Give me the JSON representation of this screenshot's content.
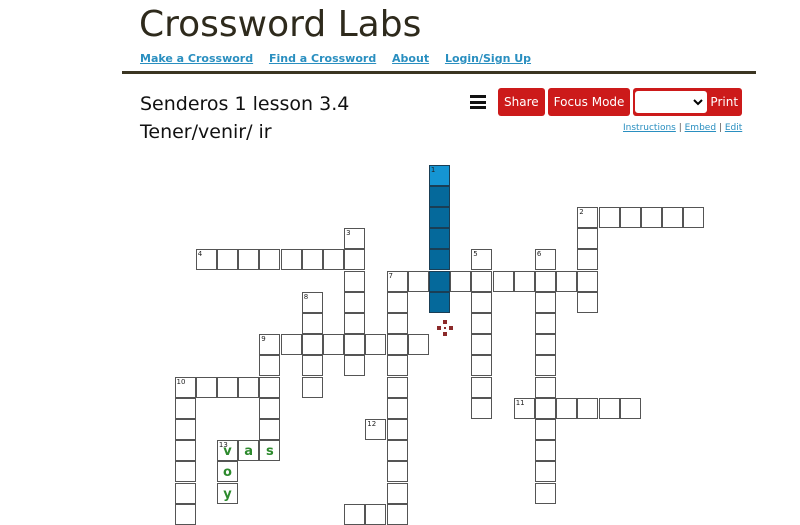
{
  "site": {
    "logo": "Crossword Labs",
    "nav": [
      "Make a Crossword",
      "Find a Crossword",
      "About",
      "Login/Sign Up"
    ]
  },
  "puzzle": {
    "title_line1": "Senderos 1 lesson 3.4",
    "title_line2": "Tener/venir/ ir"
  },
  "toolbar": {
    "menu_icon": "hamburger-menu-icon",
    "share_label": "Share",
    "focus_label": "Focus Mode",
    "print_select_value": "",
    "print_label": "Print"
  },
  "links": {
    "instructions": "Instructions",
    "embed": "Embed",
    "edit": "Edit",
    "separator": " | "
  },
  "colors": {
    "accent_red": "#cc1a1a",
    "highlight_word": "#05699b",
    "highlight_cell": "#1595d3",
    "entered_letter": "#2d8a2d",
    "link": "#2a8fc0"
  },
  "grid": {
    "words": [
      {
        "number": 1,
        "direction": "down",
        "col": 12,
        "row": 0,
        "length": 7,
        "active": true
      },
      {
        "number": 2,
        "direction": "across",
        "col": 19,
        "row": 2,
        "length": 6
      },
      {
        "number": 2,
        "direction": "down",
        "col": 19,
        "row": 2,
        "length": 5
      },
      {
        "number": 3,
        "direction": "down",
        "col": 8,
        "row": 3,
        "length": 7
      },
      {
        "number": 4,
        "direction": "across",
        "col": 1,
        "row": 4,
        "length": 8
      },
      {
        "number": 5,
        "direction": "down",
        "col": 14,
        "row": 4,
        "length": 8
      },
      {
        "number": 6,
        "direction": "down",
        "col": 17,
        "row": 4,
        "length": 12
      },
      {
        "number": 7,
        "direction": "across",
        "col": 10,
        "row": 5,
        "length": 10
      },
      {
        "number": 7,
        "direction": "down",
        "col": 10,
        "row": 5,
        "length": 12
      },
      {
        "number": 8,
        "direction": "down",
        "col": 6,
        "row": 6,
        "length": 5
      },
      {
        "number": 9,
        "direction": "across",
        "col": 4,
        "row": 8,
        "length": 8
      },
      {
        "number": 9,
        "direction": "down",
        "col": 4,
        "row": 8,
        "length": 6
      },
      {
        "number": 10,
        "direction": "across",
        "col": 0,
        "row": 10,
        "length": 5
      },
      {
        "number": 10,
        "direction": "down",
        "col": 0,
        "row": 10,
        "length": 7
      },
      {
        "number": 11,
        "direction": "across",
        "col": 16,
        "row": 11,
        "length": 6
      },
      {
        "number": 12,
        "direction": "across",
        "col": 9,
        "row": 12,
        "length": 2
      },
      {
        "number": 13,
        "direction": "across",
        "col": 2,
        "row": 13,
        "length": 3,
        "letters": [
          "v",
          "a",
          "s"
        ]
      },
      {
        "number": 13,
        "direction": "down",
        "col": 2,
        "row": 13,
        "length": 3,
        "letters": [
          "v",
          "o",
          "y"
        ]
      },
      {
        "number": null,
        "direction": "across",
        "col": 8,
        "row": 16,
        "length": 2
      }
    ]
  }
}
